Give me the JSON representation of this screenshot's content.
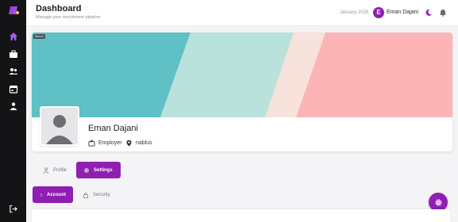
{
  "header": {
    "title": "Dashboard",
    "subtitle": "Manage your recruitment pipeline",
    "date": "January 2026",
    "user_initial": "E",
    "user_name": "Eman Dajani"
  },
  "sidebar": {
    "items": [
      {
        "icon": "home-icon"
      },
      {
        "icon": "briefcase-icon"
      },
      {
        "icon": "users-icon"
      },
      {
        "icon": "calendar-icon"
      },
      {
        "icon": "user-icon"
      }
    ],
    "logout_icon": "logout-icon"
  },
  "profile": {
    "banner_badge": "Banner",
    "name": "Eman Dajani",
    "role": "Employer",
    "location": "nablus"
  },
  "tabs": {
    "primary": [
      {
        "label": "Profile",
        "active": false
      },
      {
        "label": "Settings",
        "active": true
      }
    ],
    "secondary": [
      {
        "label": "Account",
        "active": true
      },
      {
        "label": "Security",
        "active": false
      }
    ]
  },
  "colors": {
    "accent": "#8e1fb0",
    "sidebar": "#141416",
    "banner_teal": "#5fc1c5",
    "banner_mint": "#b9e2dc",
    "banner_peach": "#f7e3dc",
    "banner_pink": "#fdb4b6"
  }
}
